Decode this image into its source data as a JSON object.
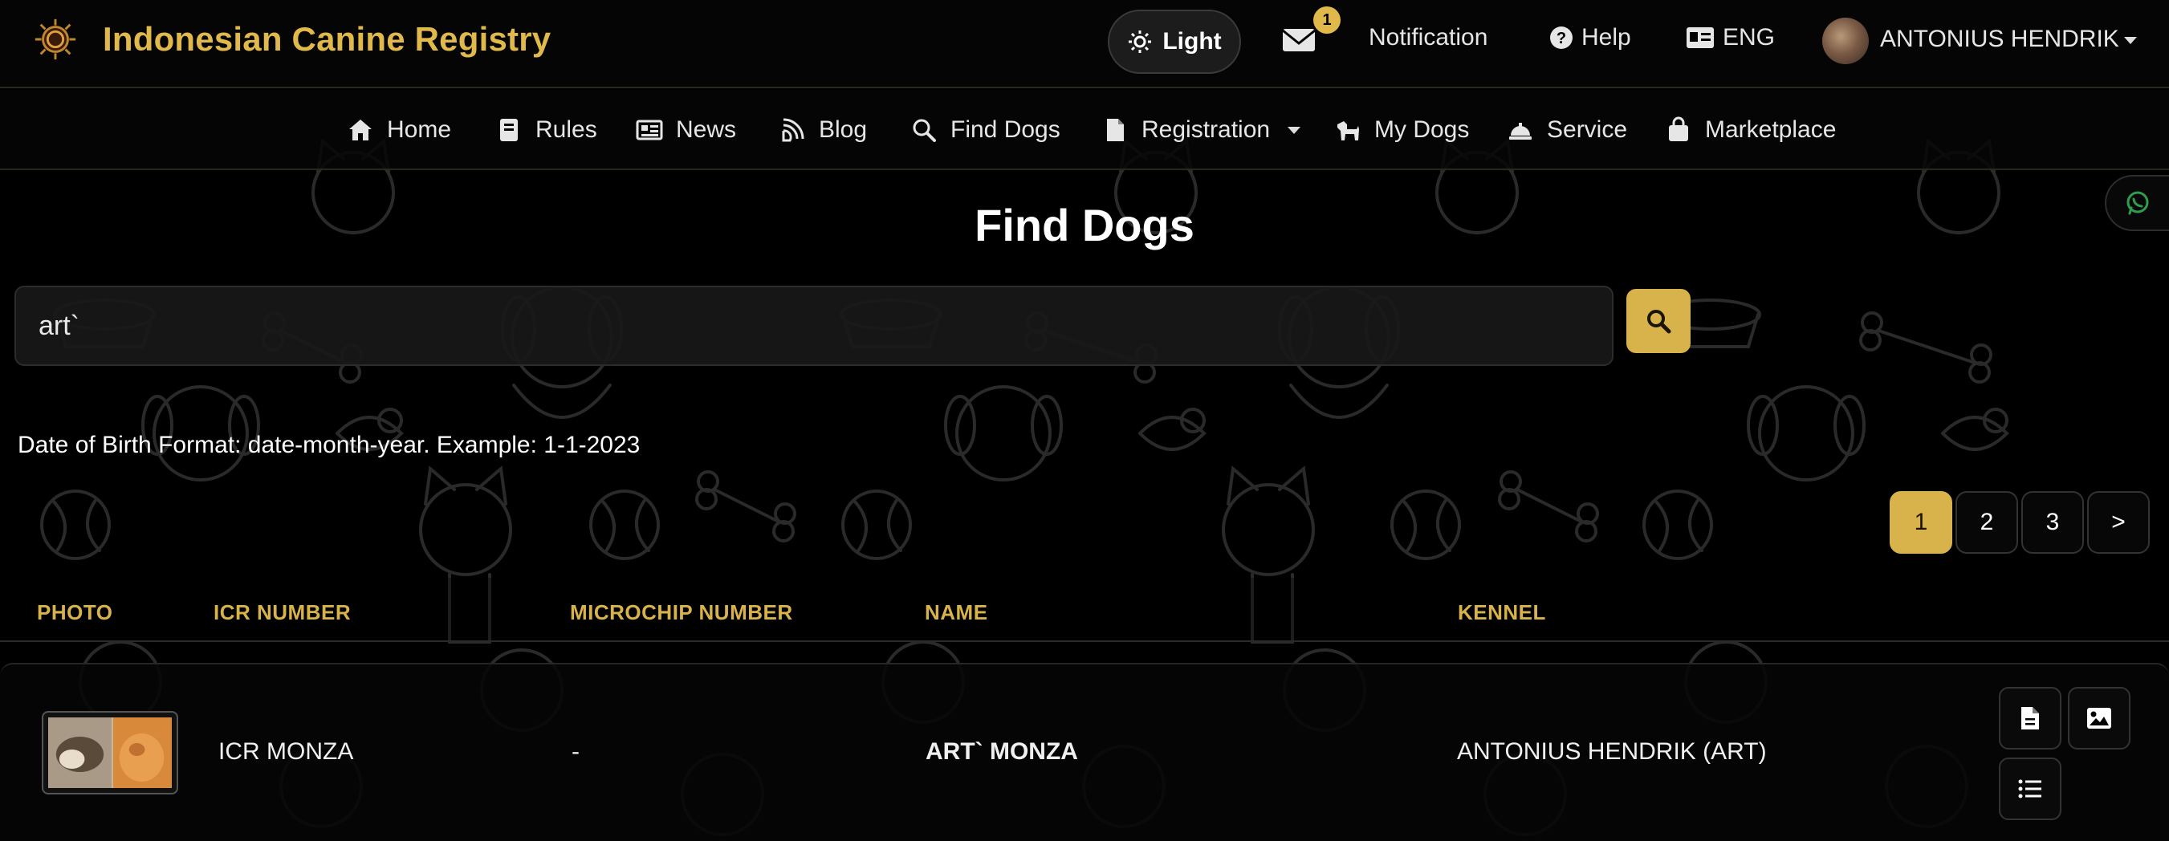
{
  "brand": {
    "name": "Indonesian Canine Registry"
  },
  "topbar": {
    "theme_label": "Light",
    "mail_count": "1",
    "notification_label": "Notification",
    "help_label": "Help",
    "lang_label": "ENG",
    "user_name": "ANTONIUS HENDRIK"
  },
  "nav": {
    "items": [
      {
        "label": "Home",
        "icon": "home-icon"
      },
      {
        "label": "Rules",
        "icon": "book-icon"
      },
      {
        "label": "News",
        "icon": "newspaper-icon"
      },
      {
        "label": "Blog",
        "icon": "blog-icon"
      },
      {
        "label": "Find Dogs",
        "icon": "search-icon"
      },
      {
        "label": "Registration",
        "icon": "file-icon"
      },
      {
        "label": "My Dogs",
        "icon": "dog-icon"
      },
      {
        "label": "Service",
        "icon": "service-bell-icon"
      },
      {
        "label": "Marketplace",
        "icon": "shopping-bag-icon"
      }
    ]
  },
  "page": {
    "title": "Find Dogs",
    "search_value": "art`",
    "dob_hint": "Date of Birth Format: date-month-year. Example: 1-1-2023"
  },
  "pagination": {
    "pages": [
      "1",
      "2",
      "3"
    ],
    "next": ">",
    "active": "1"
  },
  "table": {
    "headers": [
      "PHOTO",
      "ICR NUMBER",
      "MICROCHIP NUMBER",
      "NAME",
      "KENNEL"
    ],
    "rows": [
      {
        "icr_number": "ICR MONZA",
        "microchip": "-",
        "name": "ART` MONZA",
        "kennel": "ANTONIUS HENDRIK (ART)"
      }
    ]
  },
  "colors": {
    "accent": "#d8b24a",
    "background": "#000000",
    "brand_text": "#e0b94a"
  }
}
